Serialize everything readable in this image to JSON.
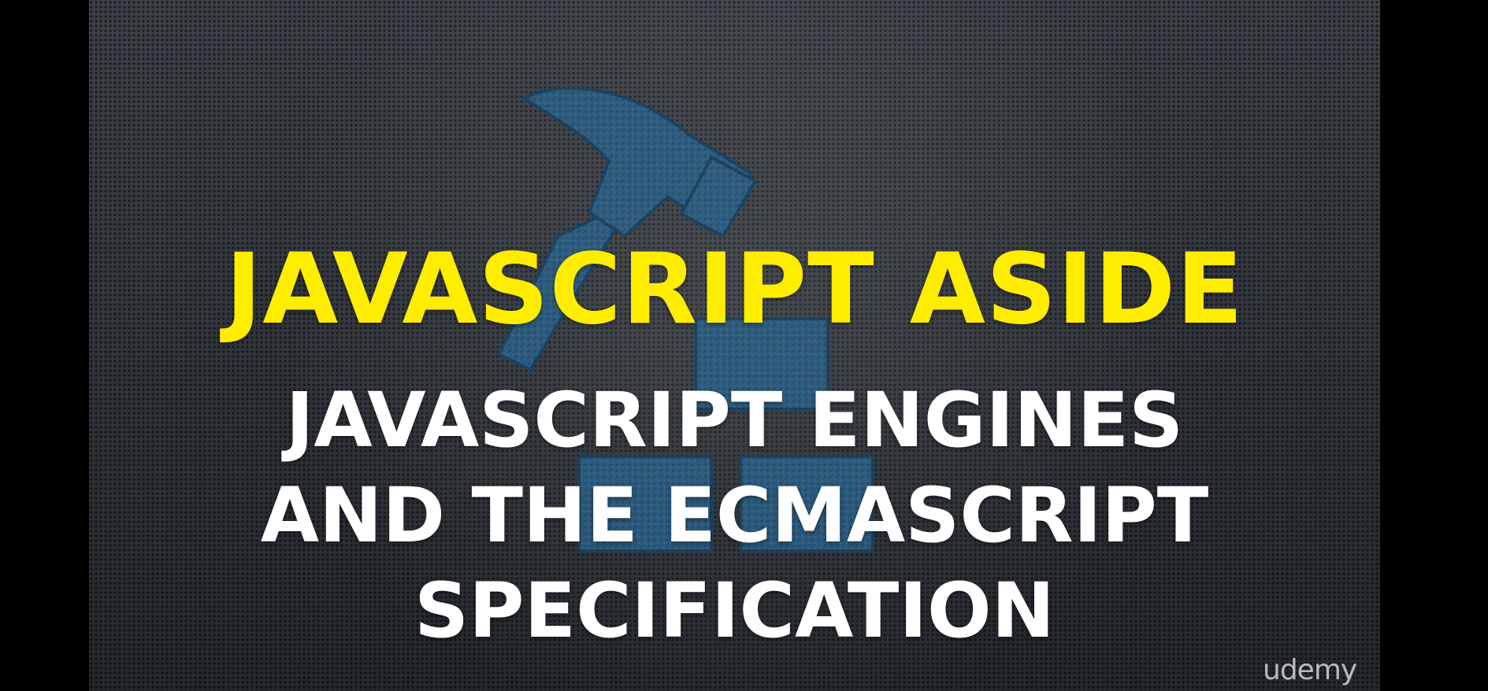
{
  "slide": {
    "title": "JAVASCRIPT ASIDE",
    "subtitle_lines": [
      "JAVASCRIPT ENGINES",
      "AND THE ECMASCRIPT",
      "SPECIFICATION"
    ],
    "title_color": "#ffed00",
    "subtitle_color": "#ffffff",
    "background_color": "#2e3238",
    "logo_icon": "hammer-and-bricks-icon",
    "watermark": "udemy"
  }
}
